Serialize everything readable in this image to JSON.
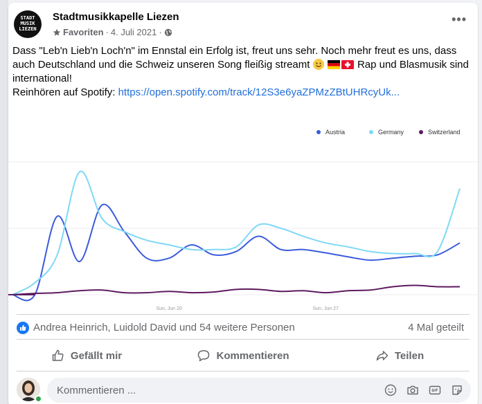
{
  "post": {
    "page_name": "Stadtmusikkapelle Liezen",
    "avatar_text": "STADT MUSIK LIEZEN",
    "audience": "Favoriten",
    "date": "4. Juli 2021",
    "more_label": "•••",
    "text_part1": "Dass \"Leb'n Lieb'n Loch'n\" im Ennstal ein Erfolg ist, freut uns sehr. Noch mehr freut es uns, dass auch Deutschland und die Schweiz unseren Song fleißig streamt",
    "text_part2": "Rap und Blasmusik sind international!",
    "link_prefix": "Reinhören auf Spotify: ",
    "link_text": "https://open.spotify.com/track/12S3e6yaZPMzZBtUHRcyUk..."
  },
  "chart_data": {
    "type": "line",
    "x_ticks": [
      "Sun, Jun 20",
      "Sun, Jun 27"
    ],
    "x": [
      "Jun 13",
      "Jun 14",
      "Jun 15",
      "Jun 16",
      "Jun 17",
      "Jun 18",
      "Jun 19",
      "Jun 20",
      "Jun 21",
      "Jun 22",
      "Jun 23",
      "Jun 24",
      "Jun 25",
      "Jun 26",
      "Jun 27",
      "Jun 28",
      "Jun 29",
      "Jun 30",
      "Jul 1",
      "Jul 2",
      "Jul 3"
    ],
    "series": [
      {
        "name": "Austria",
        "color": "#3b5bdb",
        "values": [
          0,
          0,
          118,
          50,
          135,
          95,
          55,
          55,
          75,
          60,
          65,
          88,
          68,
          68,
          63,
          57,
          52,
          55,
          58,
          60,
          78
        ]
      },
      {
        "name": "Germany",
        "color": "#7fd8f7",
        "values": [
          0,
          18,
          60,
          185,
          115,
          95,
          82,
          75,
          68,
          68,
          72,
          105,
          100,
          88,
          78,
          72,
          65,
          62,
          62,
          65,
          160
        ]
      },
      {
        "name": "Switzerland",
        "color": "#5c1a5e",
        "values": [
          0,
          2,
          3,
          6,
          7,
          3,
          3,
          5,
          3,
          4,
          8,
          8,
          5,
          6,
          3,
          6,
          7,
          12,
          14,
          12,
          12
        ]
      }
    ],
    "ylim": [
      0,
      200
    ],
    "grid": true,
    "legend_position": "top-right"
  },
  "reactions": {
    "names": "Andrea Heinrich, Luidold David und 54 weitere Personen",
    "shares": "4 Mal geteilt"
  },
  "actions": {
    "like": "Gefällt mir",
    "comment": "Kommentieren",
    "share": "Teilen"
  },
  "comment": {
    "placeholder": "Kommentieren ..."
  }
}
